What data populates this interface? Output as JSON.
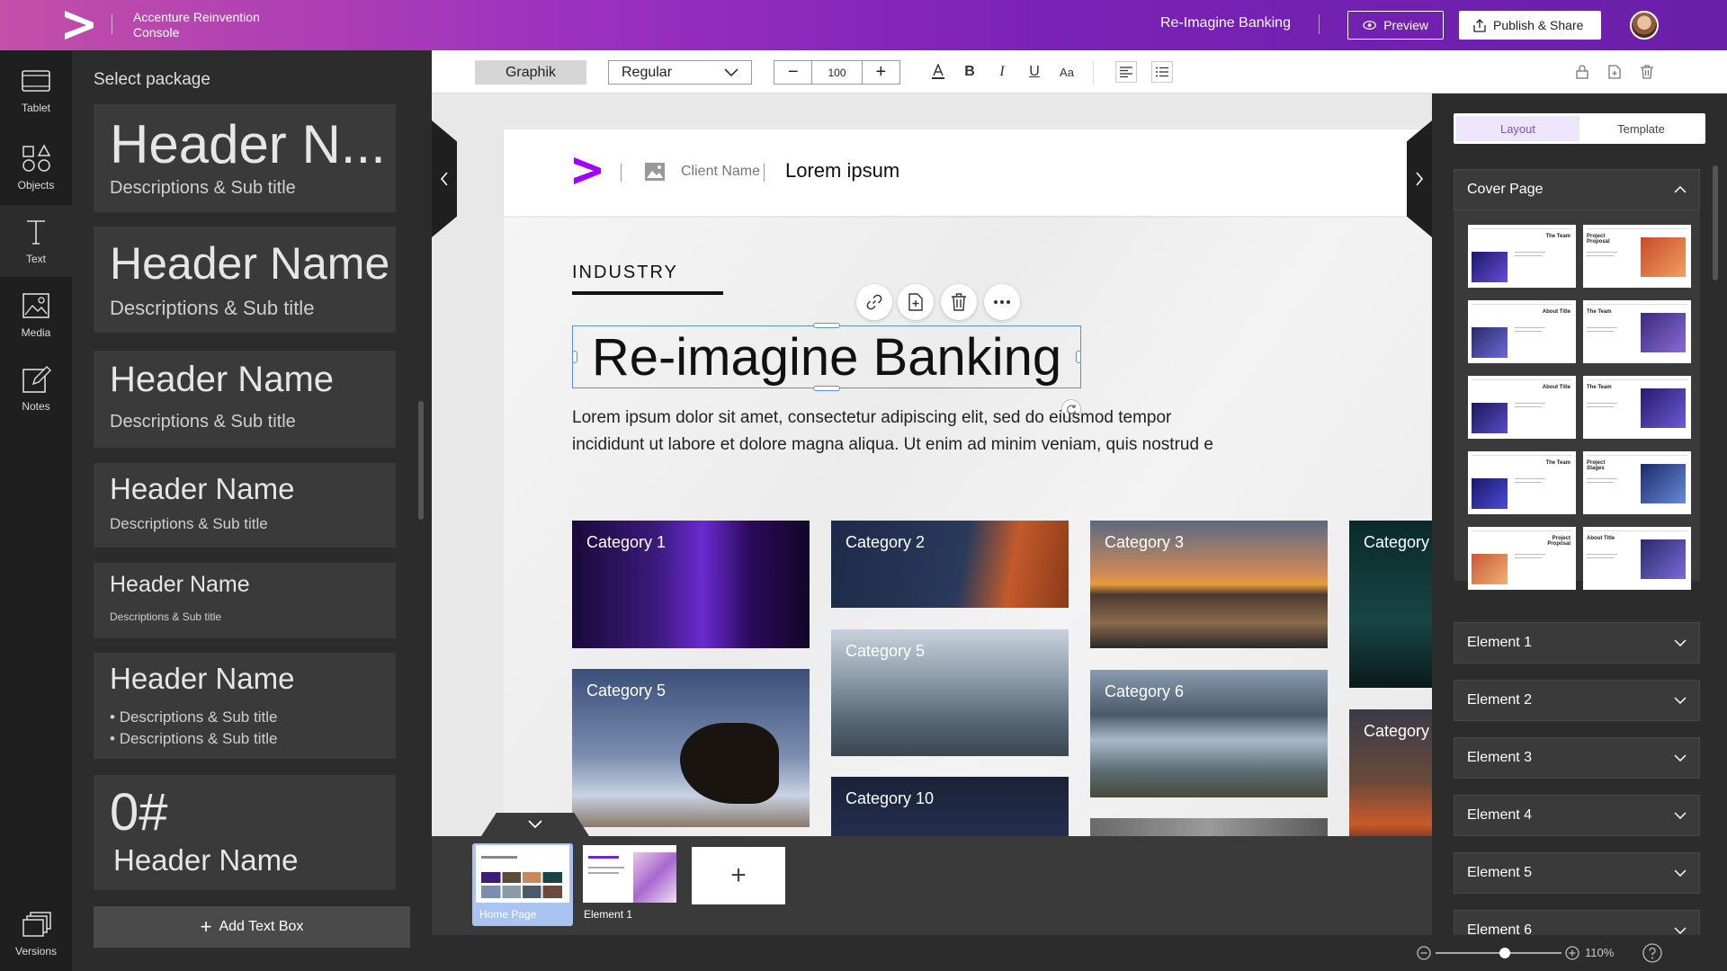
{
  "topbar": {
    "app_title": "Accenture Reinvention Console",
    "doc_title": "Re-Imagine Banking",
    "preview_label": "Preview",
    "publish_label": "Publish & Share"
  },
  "rail": {
    "items": [
      {
        "label": "Tablet",
        "icon": "tablet-icon"
      },
      {
        "label": "Objects",
        "icon": "shapes-icon"
      },
      {
        "label": "Text",
        "icon": "text-icon"
      },
      {
        "label": "Media",
        "icon": "image-icon"
      },
      {
        "label": "Notes",
        "icon": "edit-icon"
      }
    ],
    "versions_label": "Versions"
  },
  "package_panel": {
    "title": "Select package",
    "cards": [
      {
        "header": "Header N...",
        "desc": "Descriptions & Sub title"
      },
      {
        "header": "Header Name",
        "desc": "Descriptions & Sub title"
      },
      {
        "header": "Header Name",
        "desc": "Descriptions & Sub title"
      },
      {
        "header": "Header Name",
        "desc": "Descriptions & Sub title"
      },
      {
        "header": "Header Name",
        "desc": "Descriptions & Sub title"
      },
      {
        "header": "Header Name",
        "bullets": [
          "Descriptions & Sub title",
          "Descriptions & Sub title"
        ]
      },
      {
        "number": "0#",
        "header": "Header Name"
      }
    ],
    "add_text_label": "Add Text Box"
  },
  "format_toolbar": {
    "font_family": "Graphik",
    "font_weight": "Regular",
    "font_size": "100",
    "minus": "−",
    "plus": "+"
  },
  "slide": {
    "client_name": "Client Name",
    "header_text": "Lorem ipsum",
    "industry": "INDUSTRY",
    "title": "Re-imagine Banking",
    "body_line1": "Lorem ipsum dolor sit amet, consectetur adipiscing elit, sed do eiusmod tempor",
    "body_line2": "incididunt ut labore et dolore magna aliqua. Ut enim ad minim veniam, quis nostrud e",
    "categories": [
      "Category 1",
      "Category 2",
      "Category 3",
      "Category",
      "Category 5",
      "Category 5",
      "Category 6",
      "Category",
      "Category 10"
    ]
  },
  "filmstrip": {
    "pages": [
      "Home Page",
      "Element 1"
    ],
    "add_symbol": "+"
  },
  "right_panel": {
    "tabs": [
      "Layout",
      "Template"
    ],
    "cover_page_label": "Cover Page",
    "templates": [
      {
        "title": "The Team"
      },
      {
        "title": "Project Proposal"
      },
      {
        "title": "About Title"
      },
      {
        "title": "The Team"
      },
      {
        "title": "About Title"
      },
      {
        "title": "The Team"
      },
      {
        "title": "The Team"
      },
      {
        "title": "Project Stages"
      },
      {
        "title": "Project Proposal"
      },
      {
        "title": "About Title"
      }
    ],
    "elements": [
      "Element 1",
      "Element 2",
      "Element 3",
      "Element 4",
      "Element 5",
      "Element 6"
    ]
  },
  "status_bar": {
    "zoom": "110%",
    "zoom_level": 0.55
  },
  "colors": {
    "accent_purple": "#a100ff",
    "selection_blue": "#5a8fe0"
  }
}
